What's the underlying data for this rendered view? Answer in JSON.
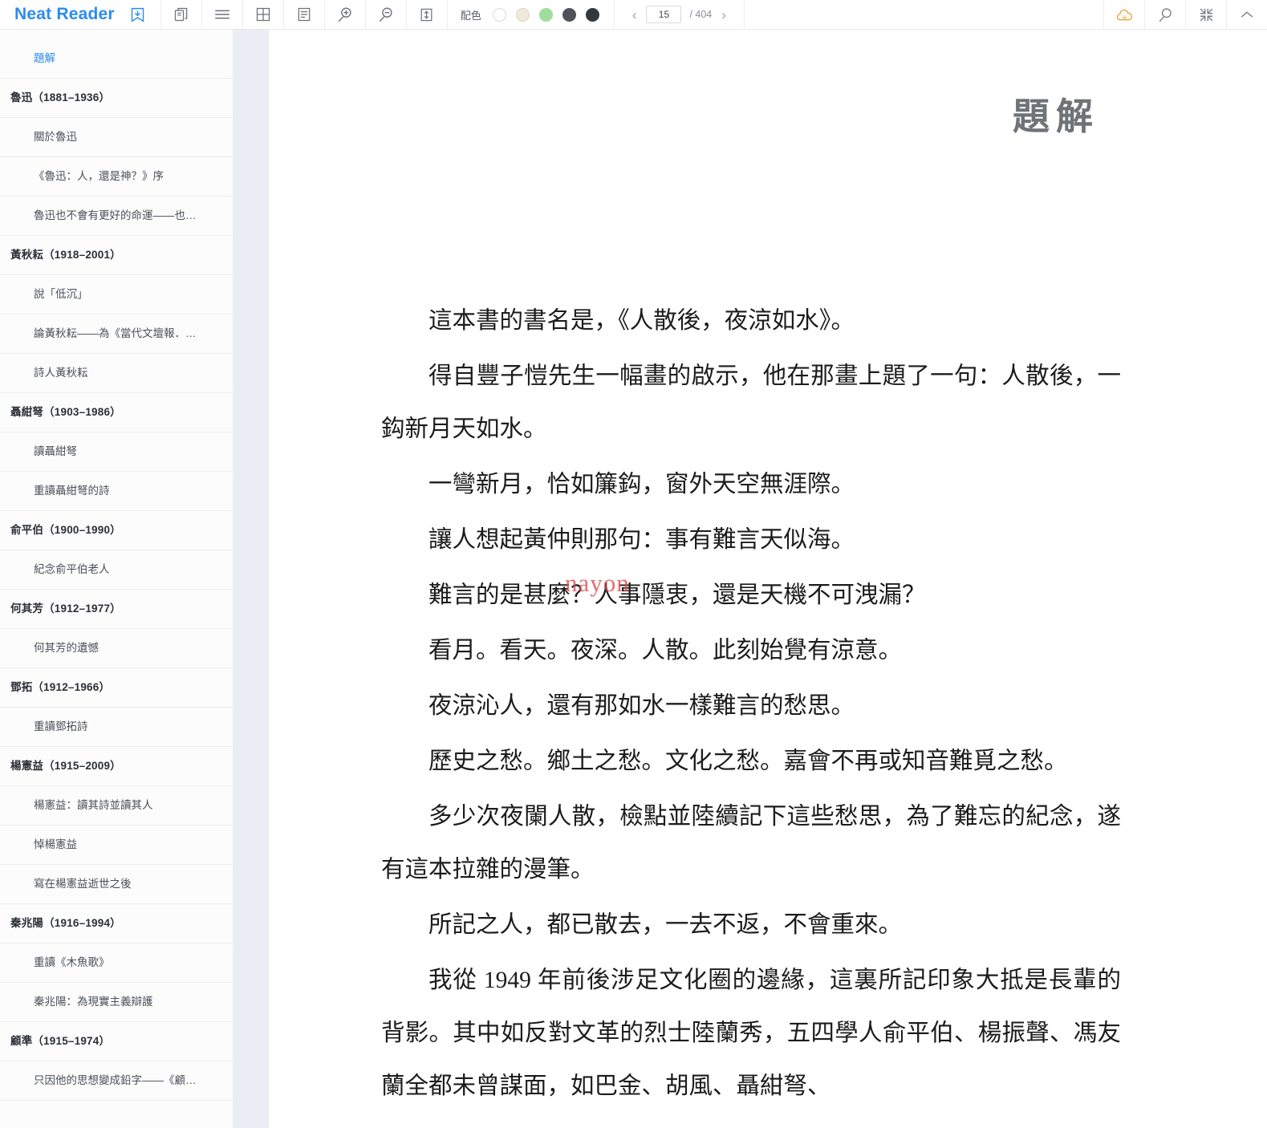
{
  "app": {
    "name": "Neat Reader",
    "brand_color": "#2b8cf0"
  },
  "toolbar": {
    "save_icon": "save-to-library-icon",
    "buttons": [
      {
        "name": "book-copy-icon",
        "label": "Book info"
      },
      {
        "name": "hamburger-menu-icon",
        "label": "Contents"
      },
      {
        "name": "grid-layout-icon",
        "label": "Grid view"
      },
      {
        "name": "text-lines-icon",
        "label": "Notes"
      },
      {
        "name": "zoom-in-icon",
        "label": "Zoom in"
      },
      {
        "name": "zoom-out-icon",
        "label": "Zoom out"
      },
      {
        "name": "line-height-icon",
        "label": "Line spacing"
      }
    ],
    "color_scheme": {
      "label": "配色",
      "swatches": [
        {
          "name": "scheme-white",
          "color": "#ffffff",
          "border": "#d9dade",
          "selected": false
        },
        {
          "name": "scheme-sepia",
          "color": "#efeada",
          "border": "#dfd9c6",
          "selected": false
        },
        {
          "name": "scheme-green",
          "color": "#9fdd9c",
          "border": "#9fdd9c",
          "selected": false
        },
        {
          "name": "scheme-dark-gray",
          "color": "#4e5359",
          "border": "#4e5359",
          "selected": false
        },
        {
          "name": "scheme-black",
          "color": "#33383d",
          "border": "#33383d",
          "selected": false
        }
      ]
    },
    "pager": {
      "prev": "‹",
      "next": "›",
      "current_page": "15",
      "total_pages": "/ 404"
    },
    "right_buttons": [
      {
        "name": "cloud-sync-icon",
        "label": "Sync",
        "color": "#e8a33d"
      },
      {
        "name": "search-icon",
        "label": "Search",
        "color": "#7a7f86"
      },
      {
        "name": "fullscreen-exit-icon",
        "label": "Fullscreen",
        "color": "#7a7f86"
      },
      {
        "name": "collapse-up-icon",
        "label": "Hide toolbar",
        "color": "#7a7f86"
      }
    ]
  },
  "sidebar": {
    "toc": [
      {
        "level": 1,
        "label": "題解",
        "active": true
      },
      {
        "level": 0,
        "label": "魯迅（1881–1936）",
        "active": false
      },
      {
        "level": 1,
        "label": "關於魯迅",
        "active": false
      },
      {
        "level": 1,
        "label": "《魯迅：人，還是神？》序",
        "active": false
      },
      {
        "level": 1,
        "label": "魯迅也不會有更好的命運——也…",
        "active": false
      },
      {
        "level": 0,
        "label": "黃秋耘（1918–2001）",
        "active": false
      },
      {
        "level": 1,
        "label": "說「低沉」",
        "active": false
      },
      {
        "level": 1,
        "label": "論黃秋耘——為《當代文壇報．…",
        "active": false
      },
      {
        "level": 1,
        "label": "詩人黃秋耘",
        "active": false
      },
      {
        "level": 0,
        "label": "聶紺弩（1903–1986）",
        "active": false
      },
      {
        "level": 1,
        "label": "讀聶紺弩",
        "active": false
      },
      {
        "level": 1,
        "label": "重讀聶紺弩的詩",
        "active": false
      },
      {
        "level": 0,
        "label": "俞平伯（1900–1990）",
        "active": false
      },
      {
        "level": 1,
        "label": "紀念俞平伯老人",
        "active": false
      },
      {
        "level": 0,
        "label": "何其芳（1912–1977）",
        "active": false
      },
      {
        "level": 1,
        "label": "何其芳的遺憾",
        "active": false
      },
      {
        "level": 0,
        "label": "鄧拓（1912–1966）",
        "active": false
      },
      {
        "level": 1,
        "label": "重讀鄧拓詩",
        "active": false
      },
      {
        "level": 0,
        "label": "楊憲益（1915–2009）",
        "active": false
      },
      {
        "level": 1,
        "label": "楊憲益：讀其詩並讀其人",
        "active": false
      },
      {
        "level": 1,
        "label": "悼楊憲益",
        "active": false
      },
      {
        "level": 1,
        "label": "寫在楊憲益逝世之後",
        "active": false
      },
      {
        "level": 0,
        "label": "秦兆陽（1916–1994）",
        "active": false
      },
      {
        "level": 1,
        "label": "重讀《木魚歌》",
        "active": false
      },
      {
        "level": 1,
        "label": "秦兆陽：為現實主義辯護",
        "active": false
      },
      {
        "level": 0,
        "label": "顧準（1915–1974）",
        "active": false
      },
      {
        "level": 1,
        "label": "只因他的思想變成鉛字——《顧…",
        "active": false
      }
    ]
  },
  "reader": {
    "title": "題解",
    "watermark": "nayon",
    "paragraphs": [
      "這本書的書名是，《人散後，夜涼如水》。",
      "得自豐子愷先生一幅畫的啟示，他在那畫上題了一句：人散後，一鈎新月天如水。",
      "一彎新月，恰如簾鈎，窗外天空無涯際。",
      "讓人想起黃仲則那句：事有難言天似海。",
      "難言的是甚麼？人事隱衷，還是天機不可洩漏？",
      "看月。看天。夜深。人散。此刻始覺有涼意。",
      "夜涼沁人，還有那如水一樣難言的愁思。",
      "歷史之愁。鄉土之愁。文化之愁。嘉會不再或知音難覓之愁。",
      "多少次夜闌人散，檢點並陸續記下這些愁思，為了難忘的紀念，遂有這本拉雜的漫筆。",
      "所記之人，都已散去，一去不返，不會重來。",
      "我從 1949 年前後涉足文化圈的邊緣，這裏所記印象大抵是長輩的背影。其中如反對文革的烈士陸蘭秀，五四學人俞平伯、楊振聲、馮友蘭全都未曾謀面，如巴金、胡風、聶紺弩、"
    ]
  }
}
